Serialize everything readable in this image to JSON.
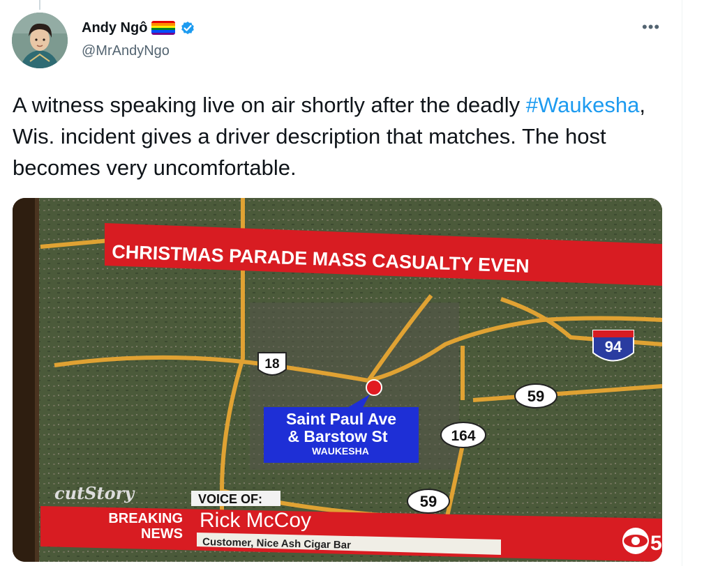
{
  "tweet": {
    "author": {
      "display_name": "Andy Ngô",
      "handle": "@MrAndyNgo",
      "verified": true,
      "badge_icon": "rainbow-flag-icon"
    },
    "more_label": "•••",
    "text_before": "A witness speaking live on air shortly after the deadly ",
    "hashtag": "#Waukesha",
    "text_after": ", Wis. incident gives a driver description that matches. The host becomes very uncomfortable.",
    "link_color": "#1d9bf0"
  },
  "video": {
    "headline": "CHRISTMAS PARADE MASS CASUALTY EVEN",
    "roads": {
      "us18": "18",
      "i94": "94",
      "wi59_a": "59",
      "wi164": "164",
      "wi59_b": "59"
    },
    "location_label": {
      "line1": "Saint Paul Ave",
      "line2": "& Barstow St",
      "line3": "WAUKESHA"
    },
    "watermark": "cutStory",
    "breaking_line1": "BREAKING",
    "breaking_line2": "NEWS",
    "voice_of_label": "VOICE OF:",
    "speaker_name": "Rick McCoy",
    "speaker_title": "Customer, Nice Ash Cigar Bar",
    "station_logo": "CBS",
    "station_number": "5",
    "colors": {
      "banner_red": "#d81c22",
      "location_blue": "#1e2fd6",
      "road_orange": "#e0a233",
      "map_green": "#4b5a3a"
    }
  }
}
